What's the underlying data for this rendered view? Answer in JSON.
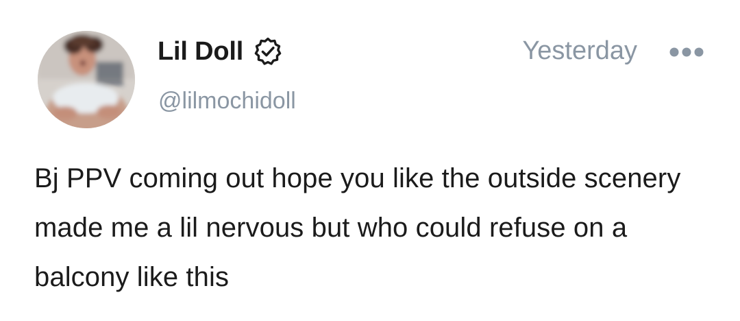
{
  "post": {
    "author": {
      "display_name": "Lil Doll",
      "handle": "@lilmochidoll",
      "avatar_icon": "profile-photo",
      "verified_icon": "verified-badge-icon"
    },
    "timestamp": "Yesterday",
    "more_icon": "more-horizontal-icon",
    "text": "Bj PPV coming out hope you like the outside scenery made me a lil nervous but who could refuse on a balcony like this"
  },
  "colors": {
    "primary_text": "#1b1b1b",
    "secondary_text": "#8a96a3",
    "background": "#ffffff"
  }
}
